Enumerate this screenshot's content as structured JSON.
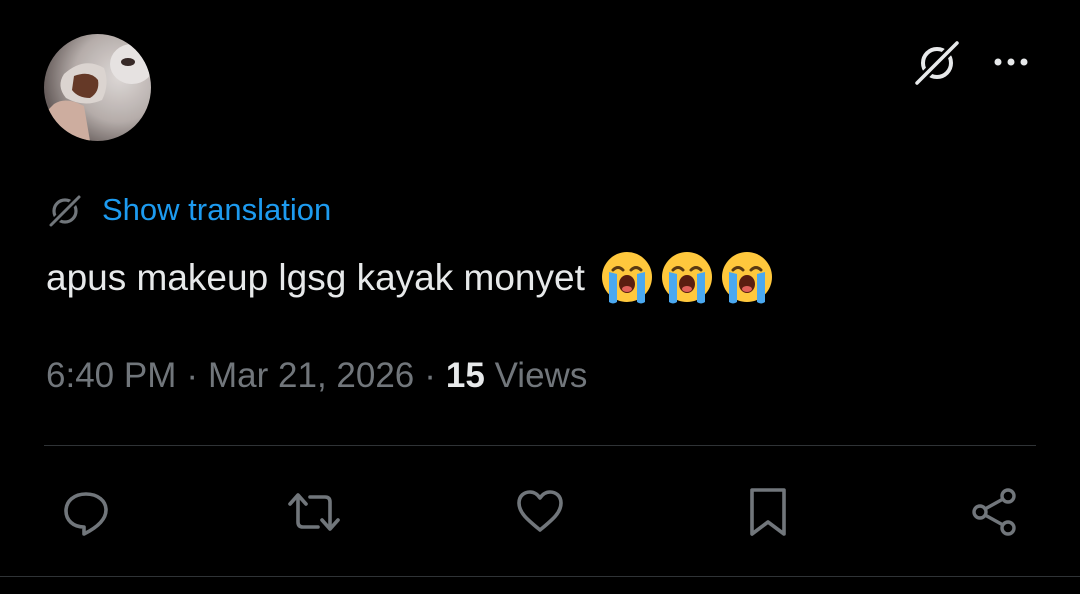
{
  "avatar": {
    "alt_icon": "profile-avatar"
  },
  "header": {
    "grok_icon": "grok-icon",
    "more_icon": "more-dots-icon"
  },
  "translation": {
    "label": "Show translation",
    "icon": "grok-icon",
    "color": "#1d9bf0"
  },
  "tweet": {
    "text": "apus makeup lgsg kayak monyet",
    "emoji": [
      "loudly-crying-face",
      "loudly-crying-face",
      "loudly-crying-face"
    ]
  },
  "meta": {
    "time": "6:40 PM",
    "separator": "·",
    "date": "Mar 21, 2026",
    "views_count": "15",
    "views_label": "Views"
  },
  "actions": [
    {
      "icon": "reply-icon"
    },
    {
      "icon": "retweet-icon"
    },
    {
      "icon": "like-icon"
    },
    {
      "icon": "bookmark-icon"
    },
    {
      "icon": "share-icon"
    }
  ],
  "colors": {
    "background": "#000000",
    "text": "#e7e9ea",
    "muted": "#71767b",
    "accent": "#1d9bf0",
    "border": "#2f3336"
  }
}
